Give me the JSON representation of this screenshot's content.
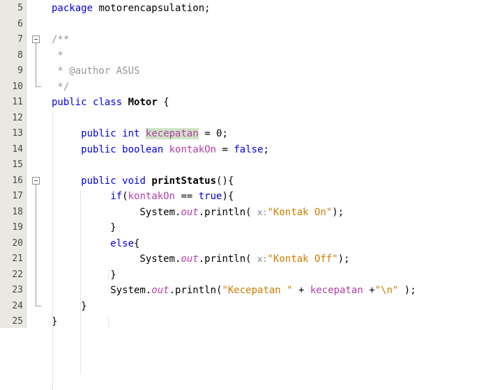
{
  "editor": {
    "lines": [
      {
        "num": "5",
        "parts": [
          {
            "t": "package",
            "c": "kw"
          },
          {
            "t": " motorencapsulation;",
            "c": ""
          }
        ]
      },
      {
        "num": "6",
        "parts": []
      },
      {
        "num": "7",
        "parts": [
          {
            "t": "/**",
            "c": "cm"
          }
        ],
        "fold": "open"
      },
      {
        "num": "8",
        "parts": [
          {
            "t": " *",
            "c": "cm"
          }
        ]
      },
      {
        "num": "9",
        "parts": [
          {
            "t": " * @author ASUS",
            "c": "cm"
          }
        ]
      },
      {
        "num": "10",
        "parts": [
          {
            "t": " */",
            "c": "cm"
          }
        ],
        "fold": "end"
      },
      {
        "num": "11",
        "parts": [
          {
            "t": "public",
            "c": "kw"
          },
          {
            "t": " ",
            "c": ""
          },
          {
            "t": "class",
            "c": "kw"
          },
          {
            "t": " ",
            "c": ""
          },
          {
            "t": "Motor",
            "c": "bold"
          },
          {
            "t": " {",
            "c": ""
          }
        ]
      },
      {
        "num": "12",
        "parts": []
      },
      {
        "num": "13",
        "parts": [
          {
            "t": "     ",
            "c": ""
          },
          {
            "t": "public",
            "c": "kw"
          },
          {
            "t": " ",
            "c": ""
          },
          {
            "t": "int",
            "c": "kw"
          },
          {
            "t": " ",
            "c": ""
          },
          {
            "t": "kecepatan",
            "c": "hl"
          },
          {
            "t": " = 0;",
            "c": ""
          }
        ]
      },
      {
        "num": "14",
        "parts": [
          {
            "t": "     ",
            "c": ""
          },
          {
            "t": "public",
            "c": "kw"
          },
          {
            "t": " ",
            "c": ""
          },
          {
            "t": "boolean",
            "c": "kw"
          },
          {
            "t": " ",
            "c": ""
          },
          {
            "t": "kontakOn",
            "c": "fld2"
          },
          {
            "t": " = ",
            "c": ""
          },
          {
            "t": "false",
            "c": "kw"
          },
          {
            "t": ";",
            "c": ""
          }
        ]
      },
      {
        "num": "15",
        "parts": []
      },
      {
        "num": "16",
        "parts": [
          {
            "t": "     ",
            "c": ""
          },
          {
            "t": "public",
            "c": "kw"
          },
          {
            "t": " ",
            "c": ""
          },
          {
            "t": "void",
            "c": "kw"
          },
          {
            "t": " ",
            "c": ""
          },
          {
            "t": "printStatus",
            "c": "bold"
          },
          {
            "t": "(){",
            "c": ""
          }
        ],
        "fold": "open"
      },
      {
        "num": "17",
        "parts": [
          {
            "t": "          ",
            "c": ""
          },
          {
            "t": "if",
            "c": "kw"
          },
          {
            "t": "(",
            "c": ""
          },
          {
            "t": "kontakOn",
            "c": "fld2"
          },
          {
            "t": " == ",
            "c": ""
          },
          {
            "t": "true",
            "c": "kw"
          },
          {
            "t": "){",
            "c": ""
          }
        ]
      },
      {
        "num": "18",
        "parts": [
          {
            "t": "               System.",
            "c": ""
          },
          {
            "t": "out",
            "c": "sfld"
          },
          {
            "t": ".println( ",
            "c": ""
          },
          {
            "t": "x:",
            "c": "hint"
          },
          {
            "t": "\"Kontak On\"",
            "c": "str"
          },
          {
            "t": ");",
            "c": ""
          }
        ]
      },
      {
        "num": "19",
        "parts": [
          {
            "t": "          }",
            "c": ""
          }
        ]
      },
      {
        "num": "20",
        "parts": [
          {
            "t": "          ",
            "c": ""
          },
          {
            "t": "else",
            "c": "kw"
          },
          {
            "t": "{",
            "c": ""
          }
        ]
      },
      {
        "num": "21",
        "parts": [
          {
            "t": "               System.",
            "c": ""
          },
          {
            "t": "out",
            "c": "sfld"
          },
          {
            "t": ".println( ",
            "c": ""
          },
          {
            "t": "x:",
            "c": "hint"
          },
          {
            "t": "\"Kontak Off\"",
            "c": "str"
          },
          {
            "t": ");",
            "c": ""
          }
        ]
      },
      {
        "num": "22",
        "parts": [
          {
            "t": "          }",
            "c": ""
          }
        ]
      },
      {
        "num": "23",
        "parts": [
          {
            "t": "          System.",
            "c": ""
          },
          {
            "t": "out",
            "c": "sfld"
          },
          {
            "t": ".println(",
            "c": ""
          },
          {
            "t": "\"Kecepatan \"",
            "c": "str"
          },
          {
            "t": " + ",
            "c": ""
          },
          {
            "t": "kecepatan",
            "c": "fld2"
          },
          {
            "t": " +",
            "c": ""
          },
          {
            "t": "\"\\n\"",
            "c": "str"
          },
          {
            "t": " );",
            "c": ""
          }
        ]
      },
      {
        "num": "24",
        "parts": [
          {
            "t": "     }",
            "c": ""
          }
        ],
        "fold": "end"
      },
      {
        "num": "25",
        "parts": [
          {
            "t": "}",
            "c": ""
          }
        ]
      }
    ]
  }
}
